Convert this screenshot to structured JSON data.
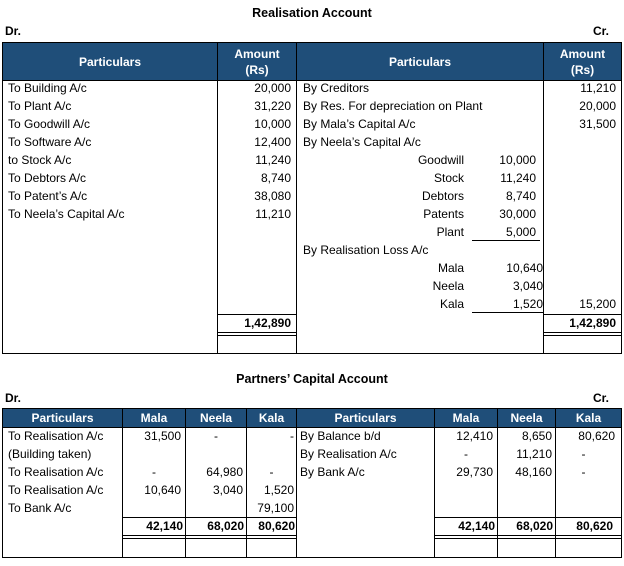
{
  "realisation": {
    "title": "Realisation Account",
    "dr": "Dr.",
    "cr": "Cr.",
    "headers": {
      "particulars": "Particulars",
      "amount_line1": "Amount",
      "amount_line2": "(Rs)"
    },
    "debit": [
      {
        "particular": "To Building A/c",
        "amount": "20,000"
      },
      {
        "particular": "To Plant A/c",
        "amount": "31,220"
      },
      {
        "particular": "To Goodwill A/c",
        "amount": "10,000"
      },
      {
        "particular": "To Software A/c",
        "amount": "12,400"
      },
      {
        "particular": "to Stock A/c",
        "amount": "11,240"
      },
      {
        "particular": "To Debtors A/c",
        "amount": "8,740"
      },
      {
        "particular": "To Patent’s A/c",
        "amount": "38,080"
      },
      {
        "particular": "To Neela’s Capital A/c",
        "amount": "11,210"
      }
    ],
    "credit": {
      "creditors": {
        "particular": "By Creditors",
        "amount": "11,210"
      },
      "reserve": {
        "particular": "By Res. For depreciation on Plant",
        "amount": "20,000"
      },
      "mala": {
        "particular": "By Mala’s Capital A/c",
        "amount": "31,500"
      },
      "neela": {
        "particular": "By Neela’s Capital A/c"
      },
      "neela_items": [
        {
          "label": "Goodwill",
          "value": "10,000"
        },
        {
          "label": "Stock",
          "value": "11,240"
        },
        {
          "label": "Debtors",
          "value": "8,740"
        },
        {
          "label": "Patents",
          "value": "30,000"
        },
        {
          "label": "Plant",
          "value": "5,000"
        }
      ],
      "loss": {
        "particular": "By Realisation Loss A/c"
      },
      "loss_items": [
        {
          "label": "Mala",
          "value": "10,640"
        },
        {
          "label": "Neela",
          "value": "3,040"
        },
        {
          "label": "Kala",
          "value": "1,520"
        }
      ],
      "loss_total": "15,200"
    },
    "total_debit": "1,42,890",
    "total_credit": "1,42,890"
  },
  "capital": {
    "title": "Partners’ Capital Account",
    "dr": "Dr.",
    "cr": "Cr.",
    "headers": [
      "Particulars",
      "Mala",
      "Neela",
      "Kala",
      "Particulars",
      "Mala",
      "Neela",
      "Kala"
    ],
    "debit": [
      {
        "particular": "To Realisation A/c",
        "mala": "31,500",
        "neela": "-",
        "kala": "-"
      },
      {
        "particular": "(Building taken)",
        "mala": "",
        "neela": "",
        "kala": ""
      },
      {
        "particular": "To Realisation A/c",
        "mala": "-",
        "neela": "64,980",
        "kala": "-"
      },
      {
        "particular": "To Realisation A/c",
        "mala": "10,640",
        "neela": "3,040",
        "kala": "1,520"
      },
      {
        "particular": "To Bank A/c",
        "mala": "",
        "neela": "",
        "kala": "79,100"
      }
    ],
    "credit": [
      {
        "particular": "By Balance b/d",
        "mala": "12,410",
        "neela": "8,650",
        "kala": "80,620"
      },
      {
        "particular": "By Realisation A/c",
        "mala": "-",
        "neela": "11,210",
        "kala": "-"
      },
      {
        "particular": "By Bank A/c",
        "mala": "29,730",
        "neela": "48,160",
        "kala": "-"
      }
    ],
    "totals": {
      "mala": "42,140",
      "neela": "68,020",
      "kala": "80,620"
    }
  }
}
